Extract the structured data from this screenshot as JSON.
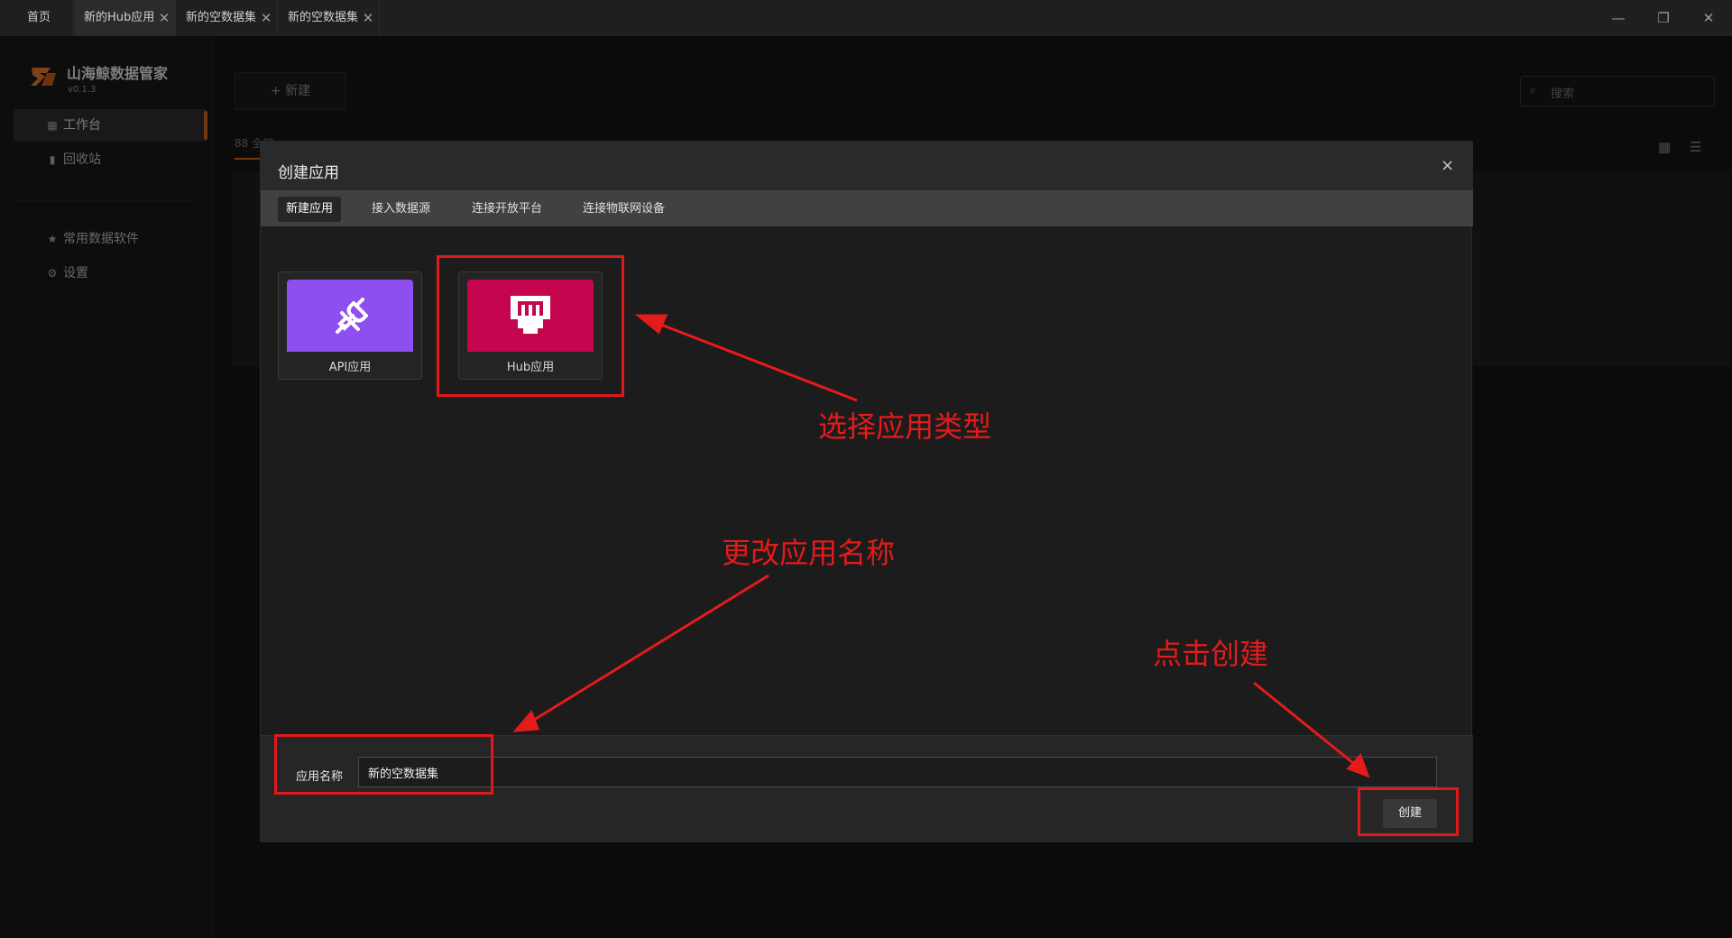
{
  "titlebar": {
    "tabs": [
      {
        "label": "首页"
      },
      {
        "label": "新的Hub应用"
      },
      {
        "label": "新的空数据集"
      },
      {
        "label": "新的空数据集"
      }
    ],
    "close_glyph": "✕",
    "minimize_glyph": "—",
    "restore_glyph": "❐",
    "window_close_glyph": "✕"
  },
  "sidebar": {
    "brand_name": "山海鲸数据管家",
    "version": "v0.1.3",
    "items": [
      {
        "label": "工作台",
        "icon": "grid-icon"
      },
      {
        "label": "回收站",
        "icon": "trash-icon"
      },
      {
        "label": "常用数据软件",
        "icon": "star-icon"
      },
      {
        "label": "设置",
        "icon": "gear-icon"
      }
    ]
  },
  "main": {
    "new_button": "+ 新建",
    "search_placeholder": "搜索",
    "filter_visible": "88 全部"
  },
  "modal": {
    "title": "创建应用",
    "close": "×",
    "tabs": [
      "新建应用",
      "接入数据源",
      "连接开放平台",
      "连接物联网设备"
    ],
    "cards": [
      {
        "label": "API应用",
        "icon": "plug-icon",
        "color": "#8f4ff0"
      },
      {
        "label": "Hub应用",
        "icon": "hub-icon",
        "color": "#c4064f"
      }
    ],
    "name_label": "应用名称",
    "name_value": "新的空数据集",
    "create_button": "创建"
  },
  "annotations": {
    "select_type": "选择应用类型",
    "rename": "更改应用名称",
    "click_create": "点击创建",
    "color": "#e51b1b"
  }
}
